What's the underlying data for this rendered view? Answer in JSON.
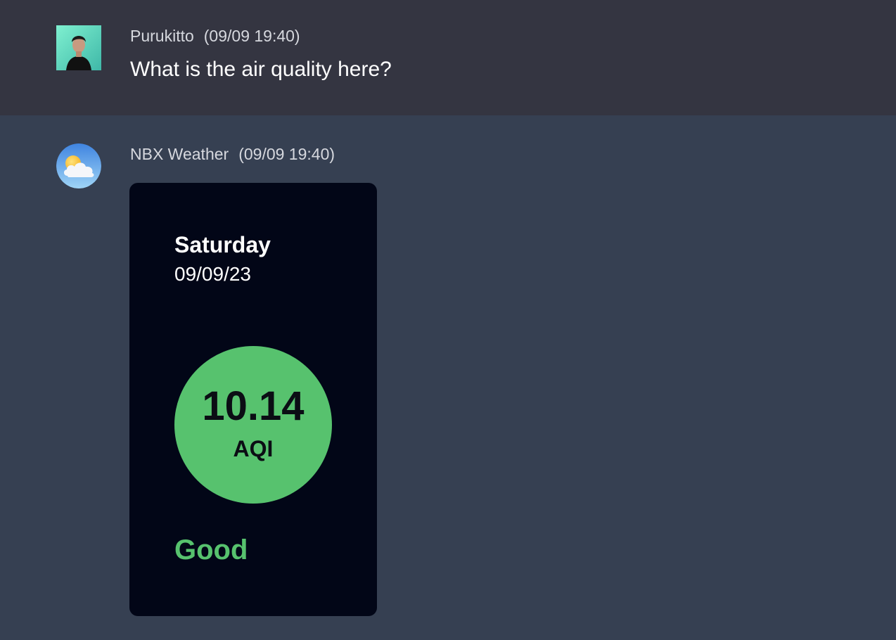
{
  "colors": {
    "user_message_bg": "#343541",
    "bot_message_bg": "#364052",
    "card_bg": "#020617",
    "aqi_good": "#57c26e"
  },
  "messages": {
    "user": {
      "avatar": "user-photo-avatar",
      "name": "Purukitto",
      "time": "(09/09 19:40)",
      "text": "What is the air quality here?"
    },
    "bot": {
      "avatar": "partly-cloudy-icon",
      "name": "NBX Weather",
      "time": "(09/09 19:40)",
      "card": {
        "day": "Saturday",
        "date": "09/09/23",
        "aqi_value": "10.14",
        "aqi_unit": "AQI",
        "status": "Good"
      }
    }
  }
}
